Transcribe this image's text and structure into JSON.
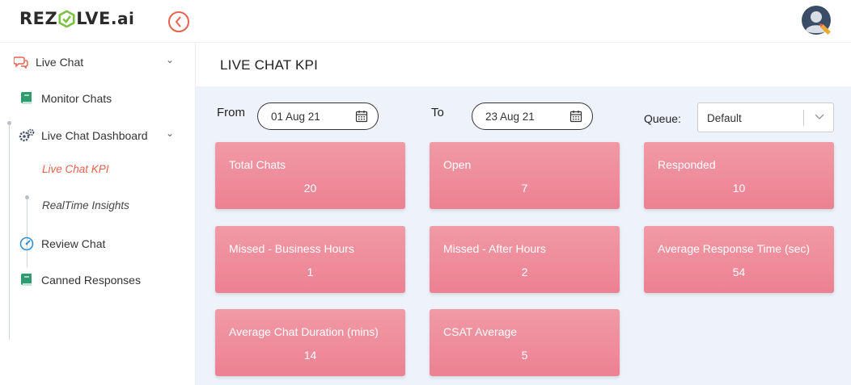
{
  "brand": {
    "logo_text_left": "REZ",
    "logo_text_right": "LVE",
    "logo_suffix": ".ai",
    "accent_color": "#e8614f",
    "logo_mark_color": "#7cc243"
  },
  "header": {
    "back_icon": "chevron-left-circle-icon",
    "avatar_icon": "user-avatar-icon"
  },
  "sidebar": {
    "items": [
      {
        "label": "Live Chat",
        "icon": "chat-bubbles-icon",
        "expanded": true
      },
      {
        "label": "Monitor Chats",
        "icon": "book-icon"
      },
      {
        "label": "Live Chat Dashboard",
        "icon": "gears-icon",
        "expanded": true
      },
      {
        "label": "Review Chat",
        "icon": "speedometer-icon"
      },
      {
        "label": "Canned Responses",
        "icon": "book-icon"
      }
    ],
    "sub_items": [
      {
        "label": "Live Chat KPI",
        "active": true
      },
      {
        "label": "RealTime Insights",
        "active": false
      }
    ]
  },
  "page": {
    "title": "LIVE CHAT KPI"
  },
  "filters": {
    "from_label": "From",
    "from_value": "01 Aug 21",
    "to_label": "To",
    "to_value": "23 Aug 21",
    "queue_label": "Queue:",
    "queue_value": "Default"
  },
  "kpis": [
    {
      "title": "Total Chats",
      "value": "20"
    },
    {
      "title": "Open",
      "value": "7"
    },
    {
      "title": "Responded",
      "value": "10"
    },
    {
      "title": "Missed - Business Hours",
      "value": "1"
    },
    {
      "title": "Missed - After Hours",
      "value": "2"
    },
    {
      "title": "Average Response Time (sec)",
      "value": "54"
    },
    {
      "title": "Average Chat Duration (mins)",
      "value": "14"
    },
    {
      "title": "CSAT Average",
      "value": "5"
    }
  ],
  "colors": {
    "card_top": "#f19aa6",
    "card_bottom": "#ec8192",
    "main_bg": "#eef3fb"
  }
}
